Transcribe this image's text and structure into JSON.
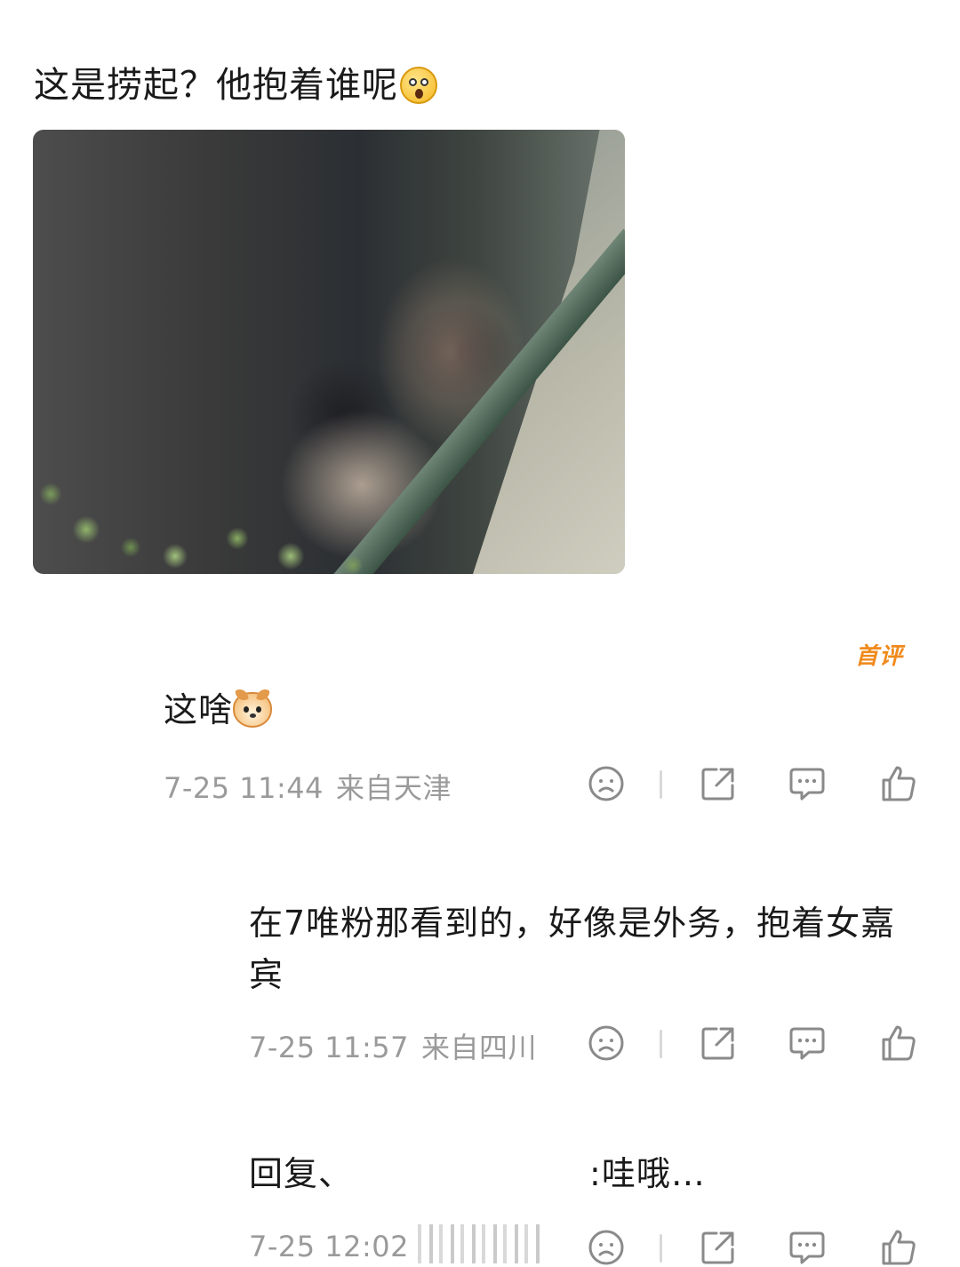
{
  "post": {
    "text": "这是捞起？他抱着谁呢",
    "emoji": "shocked-face-emoji"
  },
  "first_comment_badge": "首评",
  "comments": [
    {
      "text": "这啥",
      "emoji": "dog-face-emoji",
      "date_time": "7-25 11:44",
      "location": "来自天津"
    },
    {
      "text": "在7唯粉那看到的，好像是外务，抱着女嘉宾",
      "date_time": "7-25 11:57",
      "location": "来自四川"
    },
    {
      "text_prefix": "回复、",
      "text_suffix": ":哇哦…",
      "date_time": "7-25 12:02"
    }
  ],
  "action_icons": [
    "dislike-icon",
    "share-icon",
    "reply-icon",
    "like-icon"
  ],
  "colors": {
    "badge": "#f08a1c",
    "meta_text": "#9a9a9a",
    "icon_stroke": "#8a8a8a"
  }
}
